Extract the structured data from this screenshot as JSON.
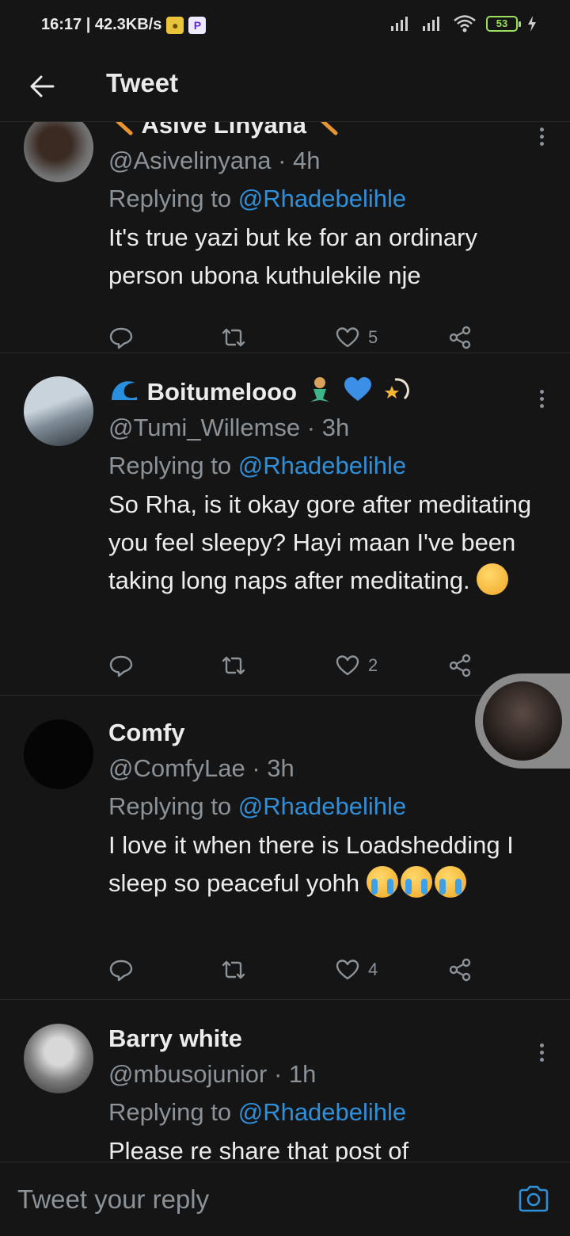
{
  "status_bar": {
    "time_speed": "16:17 | 42.3KB/s",
    "battery": "53"
  },
  "header": {
    "title": "Tweet"
  },
  "tweets": [
    {
      "name": "Asive Linyana",
      "handle_time": "@Asivelinyana · 4h",
      "replying_label": "Replying to",
      "replying_to": "@Rhadebelihle",
      "text": "It's true yazi but ke for an ordinary person ubona kuthulekile nje",
      "likes": "5"
    },
    {
      "name": "Boitumelooo",
      "handle_time": "@Tumi_Willemse · 3h",
      "replying_label": "Replying to",
      "replying_to": "@Rhadebelihle",
      "text": "So Rha, is it okay gore after meditating you feel sleepy? Hayi maan I've been taking long naps after meditating.",
      "likes": "2"
    },
    {
      "name": "Comfy",
      "handle_time": "@ComfyLae · 3h",
      "replying_label": "Replying to",
      "replying_to": "@Rhadebelihle",
      "text": "I love it when there is Loadshedding I sleep so peaceful yohh",
      "likes": "4"
    },
    {
      "name": "Barry white",
      "handle_time": "@mbusojunior · 1h",
      "replying_label": "Replying to",
      "replying_to": "@Rhadebelihle",
      "text": "Please re share that post of",
      "likes": ""
    }
  ],
  "compose": {
    "placeholder": "Tweet your reply"
  },
  "colors": {
    "background": "#151515",
    "mention": "#2f8fd8",
    "muted": "#8b9298"
  }
}
